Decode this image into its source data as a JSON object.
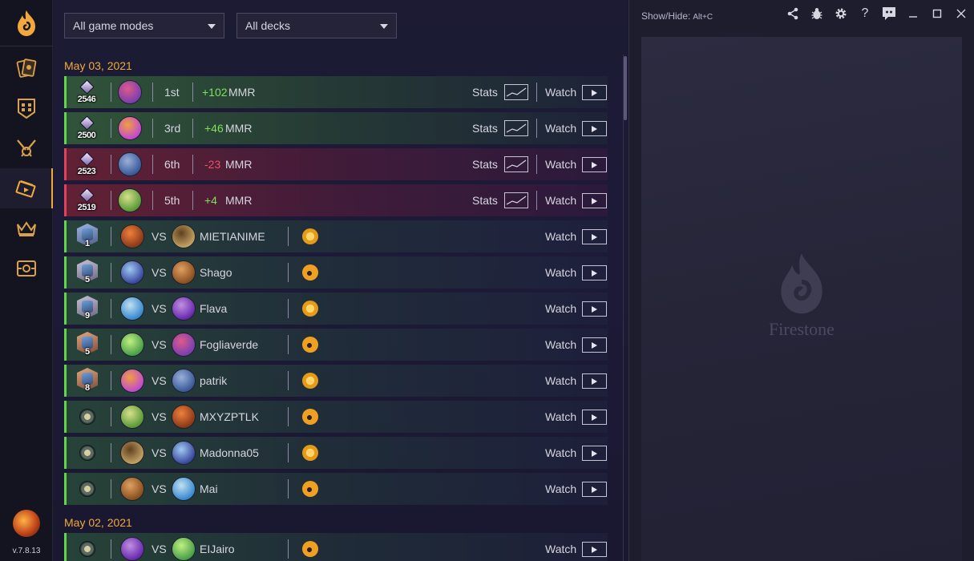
{
  "app": {
    "version": "v.7.8.13",
    "watermark": "Firestone",
    "colors": {
      "accent": "#f2a93b",
      "win": "#62d649",
      "loss": "#e0435a"
    }
  },
  "sidebar": {
    "items": [
      {
        "icon": "collection-cards-icon"
      },
      {
        "icon": "decktracker-icon"
      },
      {
        "icon": "achievements-icon"
      },
      {
        "icon": "replays-icon",
        "active": true
      },
      {
        "icon": "battlegrounds-crown-icon"
      },
      {
        "icon": "duels-icon"
      }
    ]
  },
  "filters": {
    "game_modes": "All game modes",
    "decks": "All decks"
  },
  "labels": {
    "stats": "Stats",
    "watch": "Watch",
    "mmr": "MMR",
    "vs": "VS",
    "show_hide": "Show/Hide:",
    "show_hide_key": "Alt+C"
  },
  "groups": [
    {
      "date": "May 03, 2021",
      "bg_rows": [
        {
          "mmr": "2546",
          "place": "1st",
          "delta": "+102",
          "result": "win"
        },
        {
          "mmr": "2500",
          "place": "3rd",
          "delta": "+46",
          "result": "win"
        },
        {
          "mmr": "2523",
          "place": "6th",
          "delta": "-23",
          "result": "loss"
        },
        {
          "mmr": "2519",
          "place": "5th",
          "delta": "+4",
          "result": "loss"
        }
      ],
      "ranked_rows": [
        {
          "rank": "1",
          "opponent": "MIETIANIME",
          "coin": "coin"
        },
        {
          "rank": "5",
          "opponent": "Shago",
          "coin": "flame"
        },
        {
          "rank": "9",
          "opponent": "Flava",
          "coin": "coin"
        },
        {
          "rank": "5",
          "opponent": "Fogliaverde",
          "coin": "flame"
        },
        {
          "rank": "8",
          "opponent": "patrik",
          "coin": "coin"
        },
        {
          "rank": "",
          "opponent": "MXYZPTLK",
          "coin": "flame"
        },
        {
          "rank": "",
          "opponent": "Madonna05",
          "coin": "coin"
        },
        {
          "rank": "",
          "opponent": "Mai",
          "coin": "flame"
        }
      ]
    },
    {
      "date": "May 02, 2021",
      "ranked_rows": [
        {
          "rank": "",
          "opponent": "EIJairo",
          "coin": "flame"
        }
      ]
    }
  ]
}
